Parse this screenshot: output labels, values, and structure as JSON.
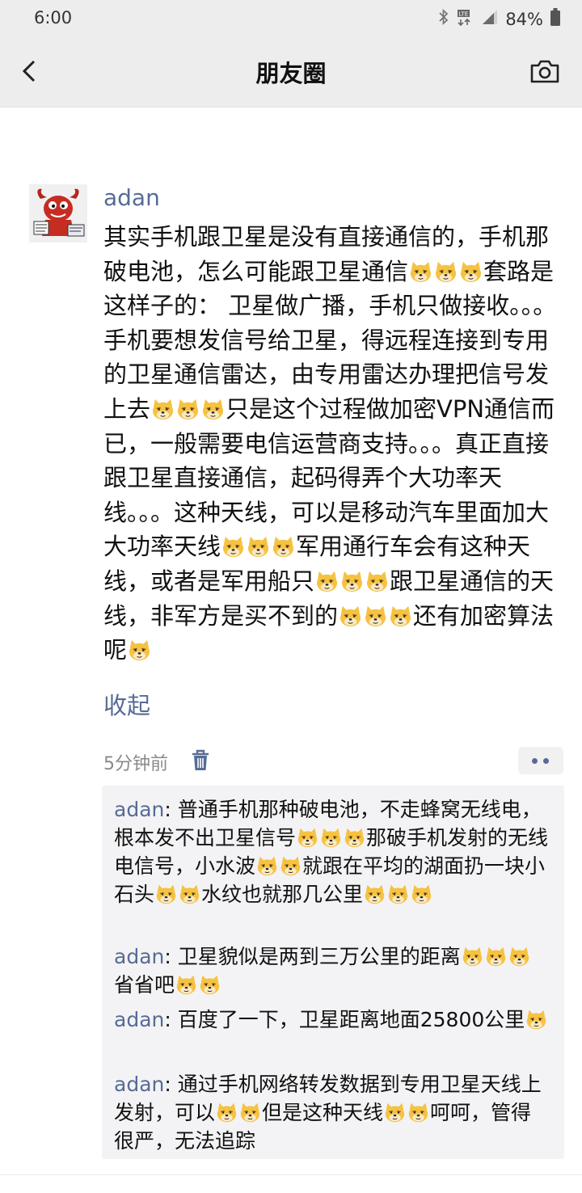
{
  "status": {
    "time": "6:00",
    "battery": "84%",
    "icons": [
      "bluetooth-icon",
      "lte-icon",
      "signal-icon",
      "battery-icon"
    ]
  },
  "nav": {
    "title": "朋友圈",
    "back_icon": "chevron-left-icon",
    "camera_icon": "camera-icon"
  },
  "post": {
    "author": "adan",
    "body": [
      {
        "t": "其实手机跟卫星是没有直接通信的，手机那破电池，怎么可能跟卫星通信"
      },
      {
        "e": 3
      },
      {
        "t": "套路是这样子的： 卫星做广播，手机只做接收。。。手机要想发信号给卫星，得远程连接到专用的卫星通信雷达，由专用雷达办理把信号发上去"
      },
      {
        "e": 3
      },
      {
        "t": "只是这个过程做加密VPN通信而已，一般需要电信运营商支持。。。真正直接跟卫星直接通信，起码得弄个大功率天线。。。这种天线，可以是移动汽车里面加大大功率天线"
      },
      {
        "e": 3
      },
      {
        "t": "军用通行车会有这种天线，或者是军用船只"
      },
      {
        "e": 3
      },
      {
        "t": "跟卫星通信的天线，非军方是买不到的"
      },
      {
        "e": 3
      },
      {
        "t": "还有加密算法呢"
      },
      {
        "e": 1
      }
    ],
    "collapse_label": "收起",
    "time": "5分钟前"
  },
  "comments": [
    {
      "name": "adan",
      "separator": ": ",
      "parts": [
        {
          "t": "普通手机那种破电池，不走蜂窝无线电，根本发不出卫星信号"
        },
        {
          "e": 3
        },
        {
          "t": "那破手机发射的无线电信号，小水波"
        },
        {
          "e": 2
        },
        {
          "t": "就跟在平均的湖面扔一块小石头"
        },
        {
          "e": 2
        },
        {
          "t": "水纹也就那几公里"
        },
        {
          "e": 3
        }
      ]
    },
    {
      "name": "adan",
      "separator": ": ",
      "parts": [
        {
          "t": "卫星貌似是两到三万公里的距离"
        },
        {
          "e": 3
        },
        {
          "t": "省省吧"
        },
        {
          "e": 2
        }
      ]
    },
    {
      "name": "adan",
      "separator": ": ",
      "parts": [
        {
          "t": "百度了一下，卫星距离地面25800公里"
        },
        {
          "e": 1
        }
      ]
    },
    {
      "name": "adan",
      "separator": ": ",
      "parts": [
        {
          "t": "通过手机网络转发数据到专用卫星天线上发射，可以"
        },
        {
          "e": 2
        },
        {
          "t": "但是这种天线"
        },
        {
          "e": 2
        },
        {
          "t": "呵呵，管得很严，无法追踪"
        }
      ]
    }
  ],
  "colors": {
    "link": "#576b95",
    "bar_bg": "#ededed",
    "comment_bg": "#f3f3f5",
    "emoji_face": "#f5c242"
  },
  "emoji_icon": "doge-emoji-icon"
}
